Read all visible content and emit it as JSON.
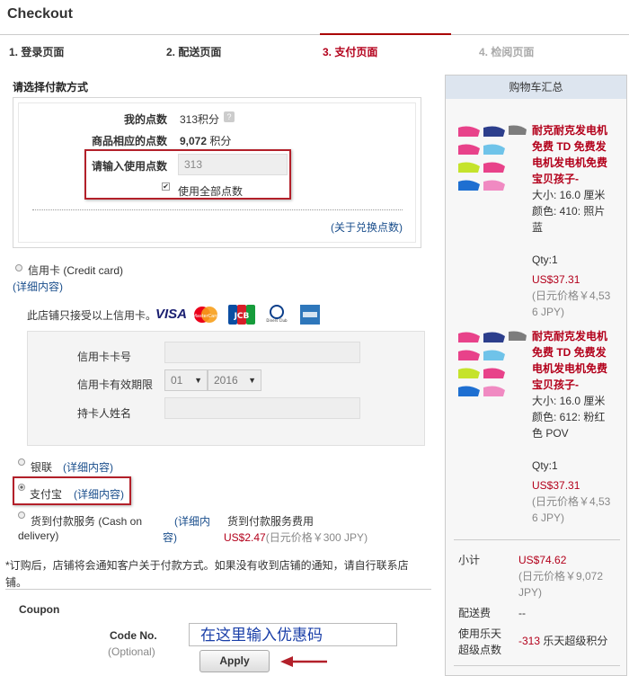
{
  "title": "Checkout",
  "steps": [
    {
      "label": "1. 登录页面",
      "state": "normal"
    },
    {
      "label": "2. 配送页面",
      "state": "normal"
    },
    {
      "label": "3. 支付页面",
      "state": "active"
    },
    {
      "label": "4. 检阅页面",
      "state": "done"
    }
  ],
  "payment": {
    "heading": "请选择付款方式",
    "points": {
      "my_points_label": "我的点数",
      "my_points_value": "313积分",
      "product_points_label": "商品相应的点数",
      "product_points_value_num": "9,072",
      "product_points_value_unit": " 积分",
      "enter_points_label": "请输入使用点数",
      "enter_points_value": "313",
      "use_all_label": "使用全部点数",
      "exchange_link": "(关于兑换点数)"
    },
    "credit_card": {
      "label": "信用卡 (Credit card)",
      "detail_link": "(详细内容)",
      "accepted_text": "此店铺只接受以上信用卡。",
      "card_number_label": "信用卡卡号",
      "expiry_label": "信用卡有效期限",
      "expiry_month": "01",
      "expiry_year": "2016",
      "holder_label": "持卡人姓名"
    },
    "unionpay": {
      "label": "银联",
      "detail_link": "(详细内容)"
    },
    "alipay": {
      "label": "支付宝",
      "detail_link": "(详细内容)"
    },
    "cod": {
      "label_line1": "货到付款服务 (Cash on",
      "label_line2": "delivery)",
      "detail_link_1": "(详细内",
      "detail_link_2": "容)",
      "fee_label": "货到付款服务费用",
      "fee_price": "US$2.47",
      "fee_jpy": "(日元价格￥300 JPY)"
    },
    "notice_line1": "*订购后，店铺将会通知客户关于付款方式。如果没有收到店铺的通知，请自行联系店",
    "notice_line2": "铺。"
  },
  "coupon": {
    "heading": "Coupon",
    "code_label": "Code No.",
    "optional_label": "(Optional)",
    "input_text": "在这里输入优惠码",
    "apply_label": "Apply"
  },
  "cart": {
    "heading": "购物车汇总",
    "items": [
      {
        "title_lines": [
          "耐克耐克发电机",
          "免费 TD 免费发",
          "电机发电机免费",
          "宝贝孩子-"
        ],
        "size": "大小: 16.0 厘米",
        "color_lines": [
          "颜色: 410: 照片",
          "蓝"
        ],
        "qty": "Qty:1",
        "price": "US$37.31",
        "jpy_lines": [
          "(日元价格￥4,53",
          "6 JPY)"
        ]
      },
      {
        "title_lines": [
          "耐克耐克发电机",
          "免费 TD 免费发",
          "电机发电机免费",
          "宝贝孩子-"
        ],
        "size": "大小: 16.0 厘米",
        "color_lines": [
          "颜色: 612: 粉红",
          "色 POV"
        ],
        "qty": "Qty:1",
        "price": "US$37.31",
        "jpy_lines": [
          "(日元价格￥4,53",
          "6 JPY)"
        ]
      }
    ],
    "subtotal_label": "小计",
    "subtotal_price": "US$74.62",
    "subtotal_jpy_lines": [
      "(日元价格￥9,072",
      "JPY)"
    ],
    "shipping_label": "配送费",
    "shipping_value": "--",
    "points_label_lines": [
      "使用乐天",
      "超级点数"
    ],
    "points_value": "-313",
    "points_unit": " 乐天超级积分"
  },
  "colors": {
    "accent_red": "#b3001b",
    "link_blue": "#1a4e8c",
    "highlight_box": "#b3202a"
  }
}
